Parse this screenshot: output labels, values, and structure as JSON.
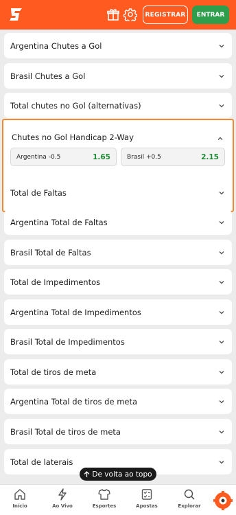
{
  "header": {
    "registrar_label": "REGISTRAR",
    "entrar_label": "ENTRAR",
    "brand_color": "#ff5a1f",
    "entrar_color": "#2e9e4c"
  },
  "markets": [
    {
      "title": "Argentina Chutes a Gol"
    },
    {
      "title": "Brasil Chutes a Gol"
    },
    {
      "title": "Total chutes no Gol (alternativas)"
    },
    {
      "title": "Total de Faltas"
    },
    {
      "title": "Argentina Total de Faltas"
    },
    {
      "title": "Brasil Total de Faltas"
    },
    {
      "title": "Total de Impedimentos"
    },
    {
      "title": "Argentina Total de Impedimentos"
    },
    {
      "title": "Brasil Total de Impedimentos"
    },
    {
      "title": "Total de tiros de meta"
    },
    {
      "title": "Argentina Total de tiros de meta"
    },
    {
      "title": "Brasil Total de tiros de meta"
    },
    {
      "title": "Total de laterais"
    }
  ],
  "expanded_market": {
    "title": "Chutes no Gol Handicap 2-Way",
    "odds": [
      {
        "label": "Argentina -0.5",
        "value": "1.65"
      },
      {
        "label": "Brasil +0.5",
        "value": "2.15"
      }
    ]
  },
  "back_to_top": "De volta ao topo",
  "nav": [
    {
      "label": "Início",
      "icon": "home-icon"
    },
    {
      "label": "Ao Vivo",
      "icon": "lightning-icon"
    },
    {
      "label": "Esportes",
      "icon": "shirt-icon"
    },
    {
      "label": "Apostas",
      "icon": "betslip-icon"
    },
    {
      "label": "Explorar",
      "icon": "search-icon"
    }
  ]
}
